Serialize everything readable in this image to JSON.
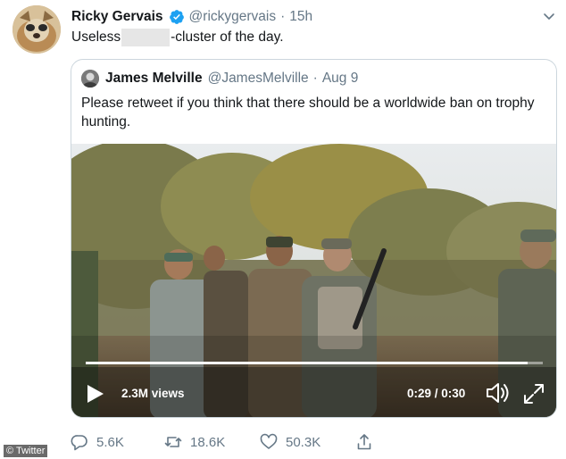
{
  "tweet": {
    "author_name": "Ricky Gervais",
    "handle": "@rickygervais",
    "separator": "·",
    "time": "15h",
    "text_before": "Useless",
    "text_after": "-cluster of the day."
  },
  "quoted_tweet": {
    "author_name": "James Melville",
    "handle": "@JamesMelville",
    "separator": "·",
    "date": "Aug 9",
    "text": "Please retweet if you think that there should be a worldwide ban on trophy hunting."
  },
  "video": {
    "views": "2.3M views",
    "time_readout": "0:29 / 0:30",
    "progress": 0.967
  },
  "actions": {
    "replies": "5.6K",
    "retweets": "18.6K",
    "likes": "50.3K"
  },
  "watermark": "© Twitter",
  "colors": {
    "verified": "#1da1f2",
    "secondary_text": "#657786",
    "border": "#ccd6dd"
  },
  "icons": {
    "verified": "verified-badge-icon",
    "caret": "chevron-down-icon",
    "play": "play-icon",
    "volume": "volume-icon",
    "fullscreen": "fullscreen-icon",
    "reply": "reply-icon",
    "retweet": "retweet-icon",
    "like": "heart-icon",
    "share": "share-icon"
  }
}
